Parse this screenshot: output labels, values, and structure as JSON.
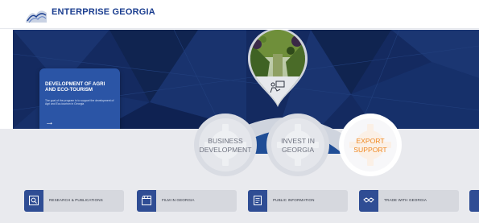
{
  "header": {
    "brand": "ENTERPRISE GEORGIA",
    "logo_icon": "enterprise-georgia-logo"
  },
  "hero": {
    "promo": {
      "title": "DEVELOPMENT OF AGRI AND ECO-TOURISM",
      "description": "The goal of the program is to support the development of Agri and Eco-tourism in Georgia",
      "arrow": "→"
    },
    "pin_icon": "investor-presentation-icon"
  },
  "pillars": [
    {
      "label_line1": "BUSINESS",
      "label_line2": "DEVELOPMENT",
      "color": "#6f7380",
      "active": false
    },
    {
      "label_line1": "INVEST IN",
      "label_line2": "GEORGIA",
      "color": "#6f7380",
      "active": false
    },
    {
      "label_line1": "EXPORT",
      "label_line2": "SUPPORT",
      "color": "#f08a24",
      "active": false
    }
  ],
  "services": [
    {
      "label": "RESEARCH & PUBLICATIONS",
      "icon": "research-icon"
    },
    {
      "label": "FILM IN GEORGIA",
      "icon": "film-clapper-icon"
    },
    {
      "label": "PUBLIC INFORMATION",
      "icon": "document-icon"
    },
    {
      "label": "TRADE WITH GEORGIA",
      "icon": "handshake-icon"
    }
  ],
  "colors": {
    "brand_blue": "#1a3d8f",
    "hero_bg": "#13295e",
    "accent_orange": "#f08a24",
    "pillar_gray": "#6f7380",
    "icon_blue": "#2f4d94"
  }
}
